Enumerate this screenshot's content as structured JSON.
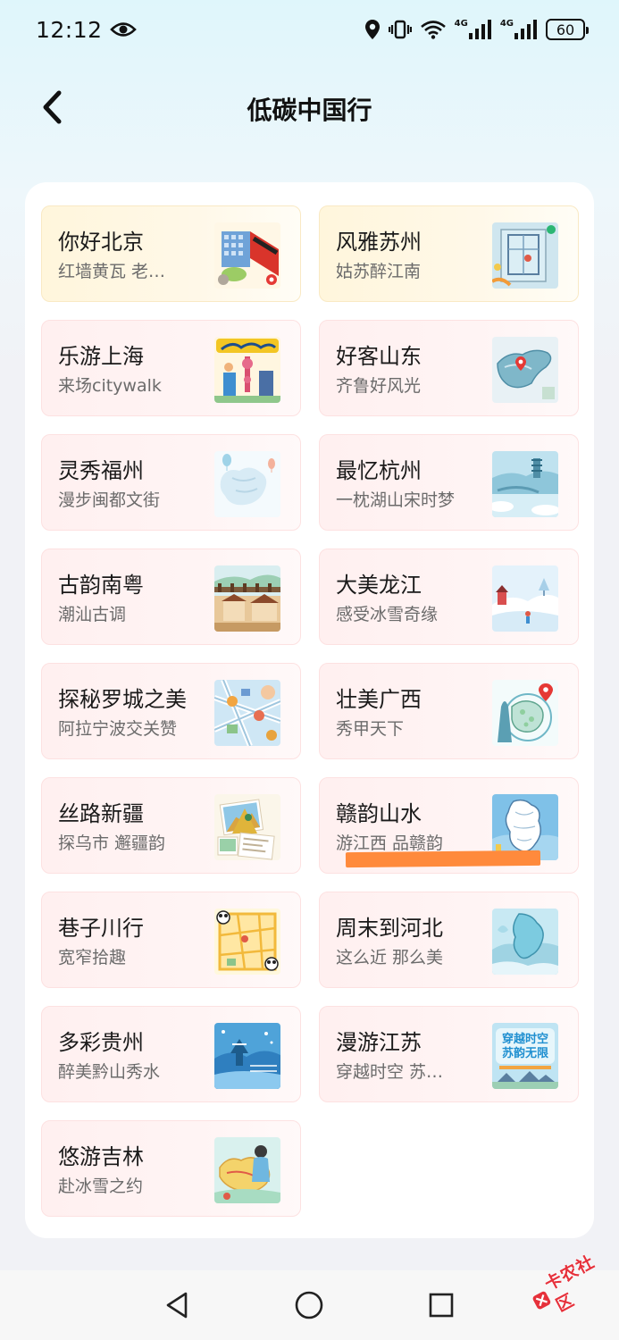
{
  "status_bar": {
    "time": "12:12",
    "network_1": "4G",
    "network_2": "4G",
    "battery": "60"
  },
  "header": {
    "title": "低碳中国行"
  },
  "cards": [
    {
      "title": "你好北京",
      "subtitle": "红墙黄瓦 老…",
      "style": "gold",
      "icon": "beijing-building-thumbnail"
    },
    {
      "title": "风雅苏州",
      "subtitle": "姑苏醉江南",
      "style": "gold",
      "icon": "suzhou-map-thumbnail"
    },
    {
      "title": "乐游上海",
      "subtitle": "来场citywalk",
      "style": "pink",
      "icon": "shanghai-citywalk-thumbnail"
    },
    {
      "title": "好客山东",
      "subtitle": "齐鲁好风光",
      "style": "pink",
      "icon": "shandong-map-thumbnail"
    },
    {
      "title": "灵秀福州",
      "subtitle": "漫步闽都文街",
      "style": "pink",
      "icon": "fuzhou-map-thumbnail"
    },
    {
      "title": "最忆杭州",
      "subtitle": "一枕湖山宋时梦",
      "style": "pink",
      "icon": "hangzhou-landscape-thumbnail"
    },
    {
      "title": "古韵南粤",
      "subtitle": "潮汕古调",
      "style": "pink",
      "icon": "chaoshan-town-thumbnail"
    },
    {
      "title": "大美龙江",
      "subtitle": "感受冰雪奇缘",
      "style": "pink",
      "icon": "heilongjiang-snow-thumbnail"
    },
    {
      "title": "探秘罗城之美",
      "subtitle": "阿拉宁波交关赞",
      "style": "pink",
      "icon": "ningbo-map-thumbnail"
    },
    {
      "title": "壮美广西",
      "subtitle": "秀甲天下",
      "style": "pink",
      "icon": "guangxi-map-thumbnail"
    },
    {
      "title": "丝路新疆",
      "subtitle": "探乌市 邂疆韵",
      "style": "pink",
      "icon": "xinjiang-postcard-thumbnail"
    },
    {
      "title": "赣韵山水",
      "subtitle": "游江西 品赣韵",
      "style": "pink",
      "icon": "jiangxi-map-thumbnail"
    },
    {
      "title": "巷子川行",
      "subtitle": "宽窄拾趣",
      "style": "pink",
      "icon": "sichuan-map-thumbnail"
    },
    {
      "title": "周末到河北",
      "subtitle": "这么近 那么美",
      "style": "pink",
      "icon": "hebei-map-thumbnail"
    },
    {
      "title": "多彩贵州",
      "subtitle": "醉美黔山秀水",
      "style": "pink",
      "icon": "guizhou-scenery-thumbnail"
    },
    {
      "title": "漫游江苏",
      "subtitle": "穿越时空 苏…",
      "style": "pink",
      "icon": "jiangsu-poster-thumbnail",
      "thumb_text_1": "穿越时空",
      "thumb_text_2": "苏韵无限"
    },
    {
      "title": "悠游吉林",
      "subtitle": "赴冰雪之约",
      "style": "pink",
      "icon": "jilin-map-thumbnail"
    }
  ],
  "watermark": {
    "text": "卡农社区"
  },
  "colors": {
    "card_pink_bg": "#fff0f0",
    "card_gold_bg": "#fff6dc",
    "highlight": "#ff8a3c",
    "watermark": "#e6313b"
  }
}
